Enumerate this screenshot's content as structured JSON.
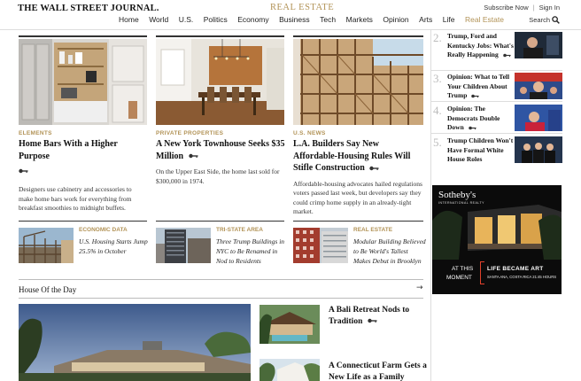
{
  "header": {
    "logo": "THE WALL STREET JOURNAL.",
    "section": "REAL ESTATE",
    "subscribe": "Subscribe Now",
    "separator": "|",
    "signin": "Sign In",
    "search": "Search",
    "nav": [
      "Home",
      "World",
      "U.S.",
      "Politics",
      "Economy",
      "Business",
      "Tech",
      "Markets",
      "Opinion",
      "Arts",
      "Life",
      "Real Estate"
    ],
    "active_nav": "Real Estate"
  },
  "top_stories": [
    {
      "category": "ELEMENTS",
      "headline": "Home Bars With a Higher Purpose",
      "dek": "Designers use cabinetry and accessories to make home bars work for everything from breakfast smoothies to midnight buffets."
    },
    {
      "category": "PRIVATE PROPERTIES",
      "headline": "A New York Townhouse Seeks $35 Million",
      "dek": "On the Upper East Side, the home last sold for $300,000 in 1974."
    },
    {
      "category": "U.S. NEWS",
      "headline": "L.A. Builders Say New Affordable-Housing Rules Will Stifle Construction",
      "dek": "Affordable-housing advocates hailed regulations voters passed last week, but developers say they could crimp home supply in an already-tight market."
    }
  ],
  "small_stories": [
    {
      "category": "ECONOMIC DATA",
      "title": "U.S. Housing Starts Jump 25.5% in October"
    },
    {
      "category": "TRI-STATE AREA",
      "title": "Three Trump Buildings in NYC to Be Renamed in Nod to Residents"
    },
    {
      "category": "REAL ESTATE",
      "title": "Modular Building Believed to Be World's Tallest Makes Debut in Brooklyn"
    }
  ],
  "house_of_day": {
    "title": "House Of the Day",
    "arrow": "→",
    "side": [
      {
        "title": "A Bali Retreat Nods to Tradition"
      },
      {
        "title": "A Connecticut Farm Gets a New Life as a Family Home"
      }
    ]
  },
  "most_popular": [
    {
      "num": "2.",
      "title": "Trump, Ford and Kentucky Jobs: What's Really Happening"
    },
    {
      "num": "3.",
      "title": "Opinion: What to Tell Your Children About Trump"
    },
    {
      "num": "4.",
      "title": "Opinion: The Democrats Double Down"
    },
    {
      "num": "5.",
      "title": "Trump Children Won't Have Formal White House Roles"
    }
  ],
  "ad": {
    "brand": "Sotheby's",
    "brand_sub": "INTERNATIONAL REALTY",
    "slogan_line1": "AT THIS",
    "slogan_line2": "MOMENT",
    "headline": "LIFE BECAME ART",
    "location": "SANTA ANA, COSTA RICA 21:45 HOURS"
  },
  "colors": {
    "accent": "#b29357",
    "ad_red": "#e2412b"
  }
}
